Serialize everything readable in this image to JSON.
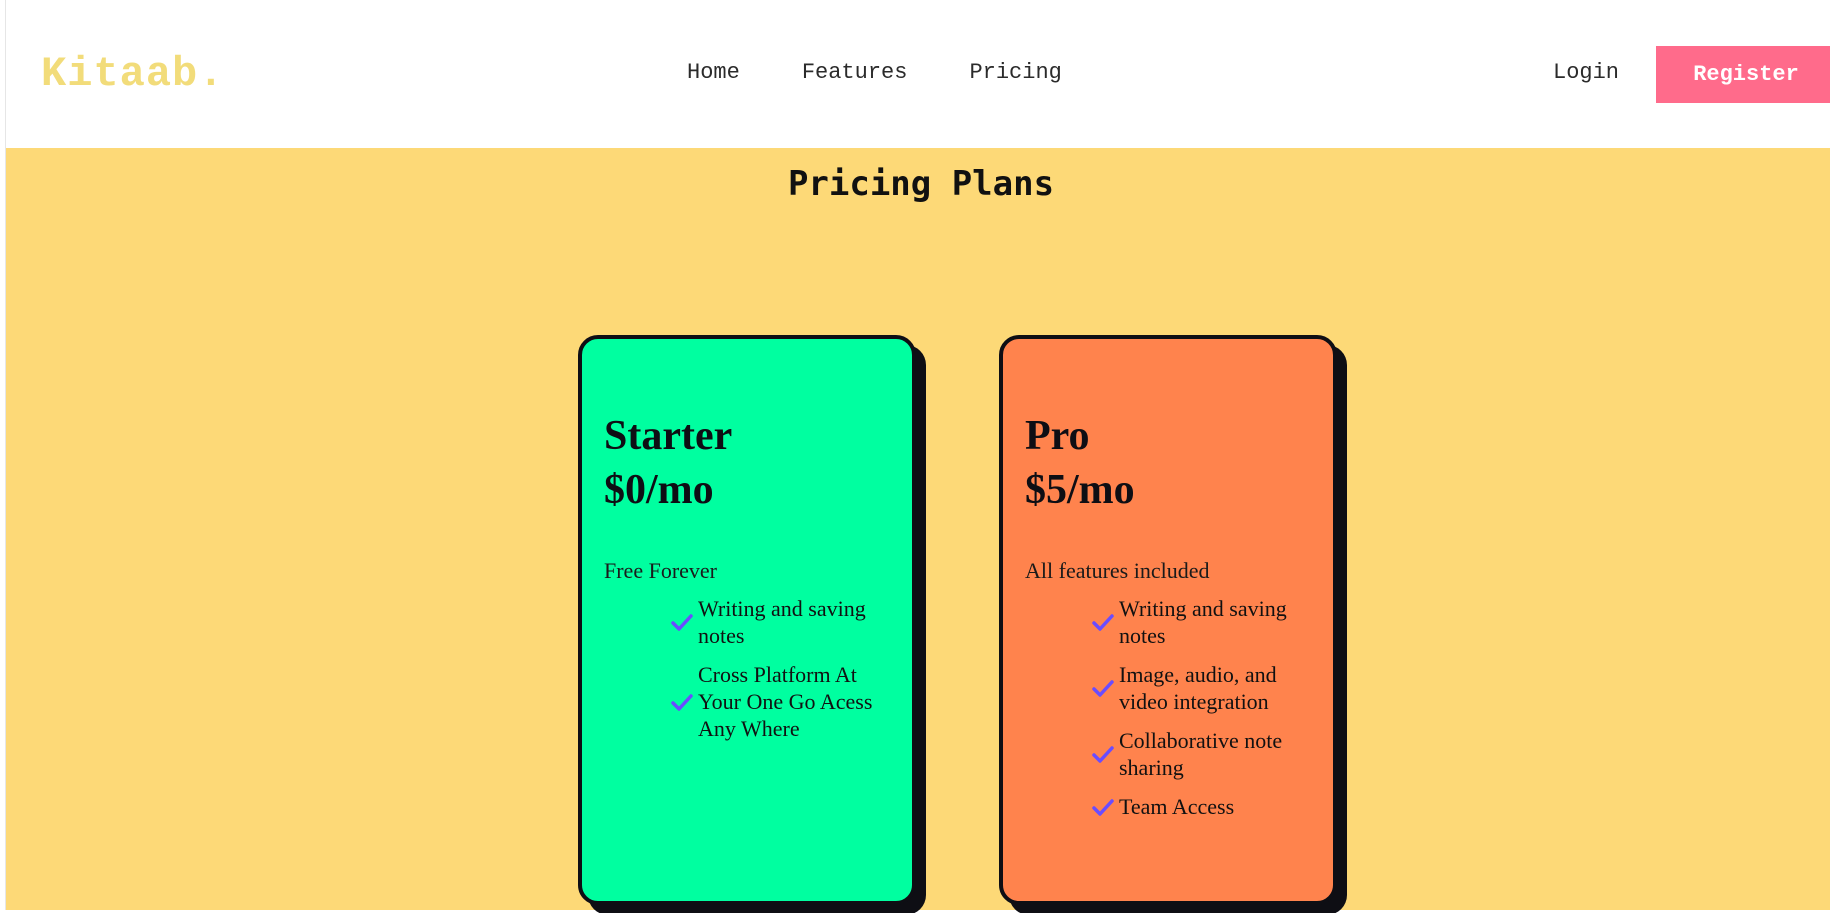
{
  "brand": {
    "logo": "Kitaab."
  },
  "nav": {
    "items": [
      "Home",
      "Features",
      "Pricing"
    ]
  },
  "auth": {
    "login_label": "Login",
    "register_label": "Register"
  },
  "page": {
    "title": "Pricing Plans"
  },
  "colors": {
    "background": "#fdd977",
    "header": "#ffffff",
    "logo": "#f2dc7a",
    "register_button": "#ff6b8b",
    "starter_card": "#00ffa0",
    "pro_card": "#ff834d",
    "check": "#6a4cff"
  },
  "plans": [
    {
      "name": "Starter",
      "price": "$0/mo",
      "subtitle": "Free Forever",
      "features": [
        "Writing and saving notes",
        "Cross Platform At Your One Go Acess Any Where"
      ]
    },
    {
      "name": "Pro",
      "price": "$5/mo",
      "subtitle": "All features included",
      "features": [
        "Writing and saving notes",
        "Image, audio, and video integration",
        "Collaborative note sharing",
        "Team Access"
      ]
    }
  ],
  "icons": {
    "feature_check": "check-icon"
  }
}
